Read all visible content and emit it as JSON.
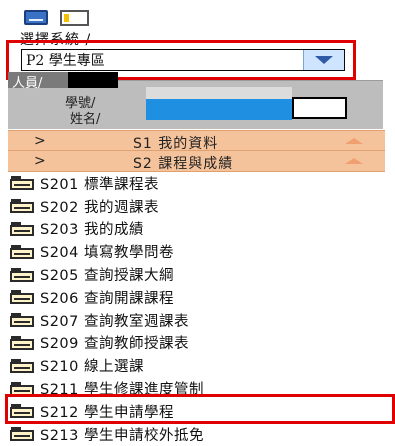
{
  "system_selector": {
    "label": "選擇系統 /",
    "selected_value": "P2 學生專區"
  },
  "user": {
    "name_tab": "人員/",
    "id_label": "學號/",
    "name_label": "姓名/"
  },
  "categories": [
    {
      "arrow": ">",
      "label": "S1 我的資料"
    },
    {
      "arrow": ">",
      "label": "S2 課程與成績"
    }
  ],
  "menu_items": [
    {
      "label": "S201 標準課程表"
    },
    {
      "label": "S202 我的週課表"
    },
    {
      "label": "S203 我的成績"
    },
    {
      "label": "S204 填寫教學問卷"
    },
    {
      "label": "S205 查詢授課大綱"
    },
    {
      "label": "S206 查詢開課課程"
    },
    {
      "label": "S207 查詢教室週課表"
    },
    {
      "label": "S209 查詢教師授課表"
    },
    {
      "label": "S210 線上選課"
    },
    {
      "label": "S211 學生修課進度管制"
    },
    {
      "label": "S212 學生申請學程"
    },
    {
      "label": "S213 學生申請校外抵免"
    }
  ],
  "colors": {
    "highlight_red": "#e00000",
    "category_bg": "#f4c39c",
    "selected_blue": "#1e8fe1"
  }
}
